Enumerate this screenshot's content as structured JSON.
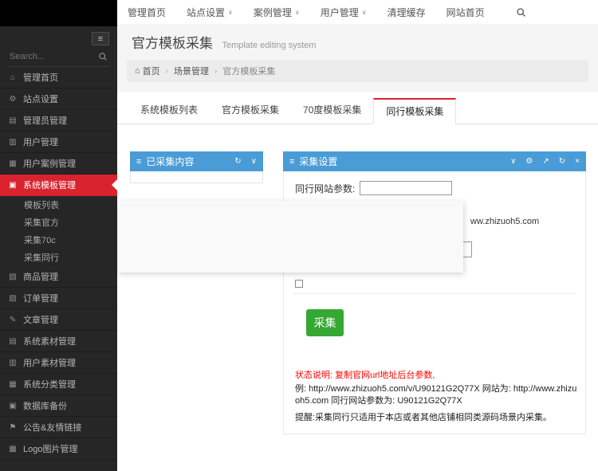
{
  "topbar": {
    "caret": "∨",
    "items": [
      {
        "label": "管理首页"
      },
      {
        "label": "站点设置",
        "dropdown": true
      },
      {
        "label": "案例管理",
        "dropdown": true
      },
      {
        "label": "用户管理",
        "dropdown": true
      },
      {
        "label": "清理缓存"
      },
      {
        "label": "网站首页"
      }
    ]
  },
  "sidebar": {
    "toggle_glyph": "≡",
    "search_placeholder": "Search...",
    "items": [
      {
        "label": "管理首页",
        "glyph": "⌂"
      },
      {
        "label": "站点设置",
        "glyph": "⚙"
      },
      {
        "label": "管理员管理",
        "glyph": "▤"
      },
      {
        "label": "用户管理",
        "glyph": "▥"
      },
      {
        "label": "用户案例管理",
        "glyph": "▦"
      },
      {
        "label": "系统模板管理",
        "glyph": "▣"
      },
      {
        "label": "商品管理",
        "glyph": "▧"
      },
      {
        "label": "订单管理",
        "glyph": "▨"
      },
      {
        "label": "文章管理",
        "glyph": "✎"
      },
      {
        "label": "系统素材管理",
        "glyph": "▤"
      },
      {
        "label": "用户素材管理",
        "glyph": "▥"
      },
      {
        "label": "系统分类管理",
        "glyph": "▦"
      },
      {
        "label": "数据库备份",
        "glyph": "▣"
      },
      {
        "label": "公告&友情链接",
        "glyph": "⚑"
      },
      {
        "label": "Logo图片管理",
        "glyph": "▦"
      }
    ],
    "submenu": [
      {
        "label": "模板列表"
      },
      {
        "label": "采集官方"
      },
      {
        "label": "采集70c"
      },
      {
        "label": "采集同行"
      }
    ]
  },
  "page": {
    "title": "官方模板采集",
    "subtitle": "Template editing system",
    "home_glyph": "⌂",
    "breadcrumb": [
      "首页",
      "场景管理",
      "官方模板采集"
    ]
  },
  "tabs": {
    "items": [
      "系统模板列表",
      "官方模板采集",
      "70度模板采集",
      "同行模板采集"
    ],
    "active": "同行模板采集"
  },
  "collected_panel": {
    "icon_glyph": "≡",
    "title": "已采集内容",
    "tools": [
      "↻",
      "∨"
    ]
  },
  "settings_panel": {
    "icon_glyph": "≡",
    "title": "采集设置",
    "tools": [
      "∨",
      "⚙",
      "↗",
      "↻",
      "×"
    ],
    "param_label": "同行网站参数:",
    "param_value": "",
    "visible_fragment": "ww.zhizuoh5.com",
    "collect_button": "采集",
    "status_note": "状态说明: 复制官网url地址后台参数,",
    "example_text": "例: http://www.zhizuoh5.com/v/U90121G2Q77X 网站为: http://www.zhizuoh5.com 同行网站参数为: U90121G2Q77X",
    "tip_text": "提醒:采集同行只适用于本店或者其他店铺相同类源码场景内采集。"
  },
  "colors": {
    "accent_red": "#d9232e",
    "panel_header_blue": "#4a9cd6",
    "button_green": "#34a832",
    "status_red": "#ff0000"
  }
}
